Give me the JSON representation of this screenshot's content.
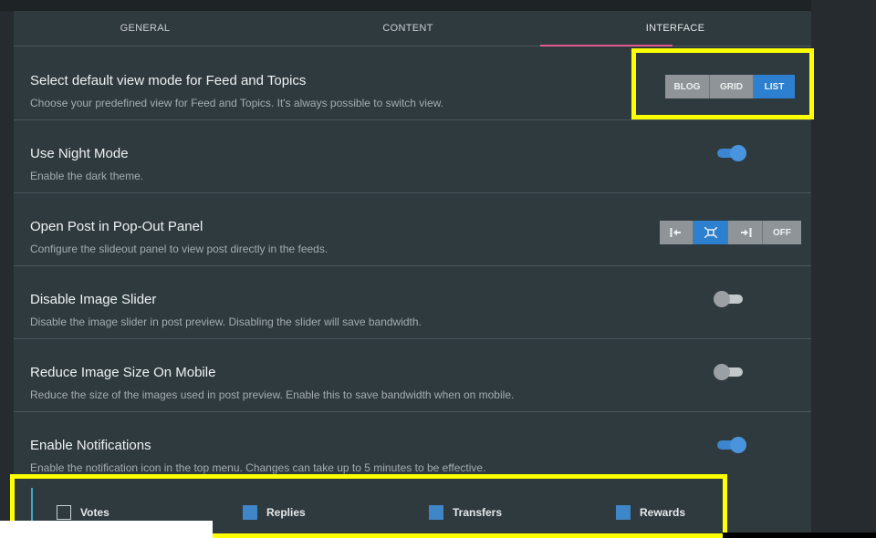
{
  "tabs": [
    {
      "label": "GENERAL"
    },
    {
      "label": "CONTENT"
    },
    {
      "label": "INTERFACE"
    }
  ],
  "settings": {
    "view_mode": {
      "title": "Select default view mode for Feed and Topics",
      "desc": "Choose your predefined view for Feed and Topics. It's always possible to switch view.",
      "options": [
        "BLOG",
        "GRID",
        "LIST"
      ],
      "selected": "LIST"
    },
    "night_mode": {
      "title": "Use Night Mode",
      "desc": "Enable the dark theme.",
      "enabled": true
    },
    "popout": {
      "title": "Open Post in Pop-Out Panel",
      "desc": "Configure the slideout panel to view post directly in the feeds.",
      "off_label": "OFF",
      "icons": [
        "dock-left-icon",
        "center-expand-icon",
        "dock-right-icon"
      ],
      "selected": "center-expand-icon"
    },
    "image_slider": {
      "title": "Disable Image Slider",
      "desc": "Disable the image slider in post preview. Disabling the slider will save bandwidth.",
      "enabled": false
    },
    "image_size": {
      "title": "Reduce Image Size On Mobile",
      "desc": "Reduce the size of the images used in post preview. Enable this to save bandwidth when on mobile.",
      "enabled": false
    },
    "notifications": {
      "title": "Enable Notifications",
      "desc": "Enable the notification icon in the top menu. Changes can take up to 5 minutes to be effective.",
      "enabled": true,
      "types": [
        {
          "label": "Votes",
          "checked": false
        },
        {
          "label": "Replies",
          "checked": true
        },
        {
          "label": "Transfers",
          "checked": true
        },
        {
          "label": "Rewards",
          "checked": true
        }
      ]
    }
  },
  "colors": {
    "accent": "#2d7fcf",
    "tab_indicator": "#e35a8e",
    "highlight": "#ffff00"
  }
}
